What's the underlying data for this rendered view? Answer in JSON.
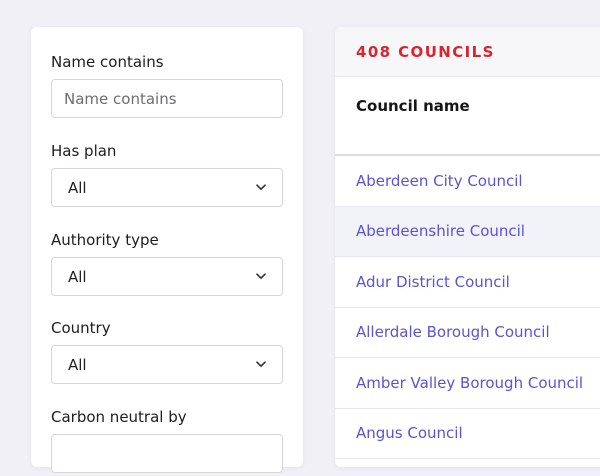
{
  "filters": {
    "name": {
      "label": "Name contains",
      "placeholder": "Name contains",
      "value": ""
    },
    "has_plan": {
      "label": "Has plan",
      "value": "All"
    },
    "authority_type": {
      "label": "Authority type",
      "value": "All"
    },
    "country": {
      "label": "Country",
      "value": "All"
    },
    "carbon_neutral": {
      "label": "Carbon neutral by",
      "value": ""
    }
  },
  "results": {
    "count_label": "408 COUNCILS",
    "column_header": "Council name",
    "rows": [
      {
        "name": "Aberdeen City Council"
      },
      {
        "name": "Aberdeenshire Council"
      },
      {
        "name": "Adur District Council"
      },
      {
        "name": "Allerdale Borough Council"
      },
      {
        "name": "Amber Valley Borough Council"
      },
      {
        "name": "Angus Council"
      }
    ]
  },
  "colors": {
    "accent_red": "#d6262f",
    "link": "#5b52d6",
    "page_bg": "#f0f0f6",
    "stripe": "#f2f2f9"
  },
  "icons": {
    "select_arrow": "chevron-down-icon"
  }
}
